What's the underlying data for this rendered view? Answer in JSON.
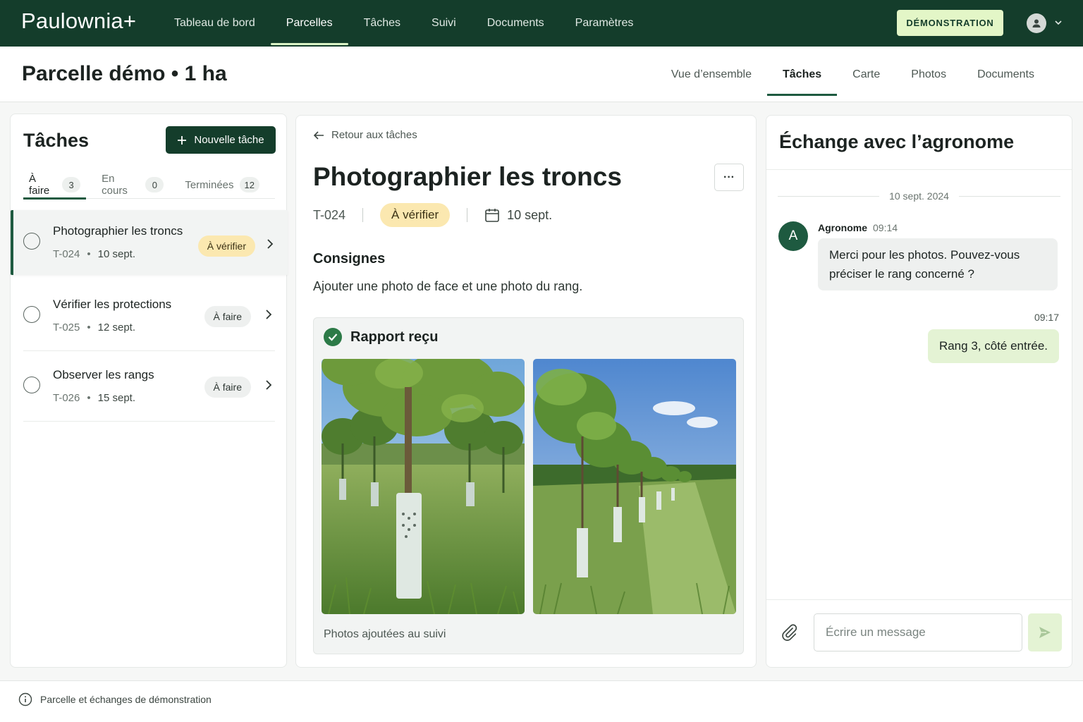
{
  "app": {
    "brand": "Paulownia+"
  },
  "nav": {
    "items": [
      {
        "label": "Tableau de bord"
      },
      {
        "label": "Parcelles"
      },
      {
        "label": "Tâches"
      },
      {
        "label": "Suivi"
      },
      {
        "label": "Documents"
      },
      {
        "label": "Paramètres"
      }
    ],
    "active": "Parcelles",
    "demo_label": "DÉMONSTRATION"
  },
  "header": {
    "title": "Parcelle démo • 1 ha",
    "tabs": [
      {
        "label": "Vue d’ensemble"
      },
      {
        "label": "Tâches"
      },
      {
        "label": "Carte"
      },
      {
        "label": "Photos"
      },
      {
        "label": "Documents"
      }
    ],
    "active_tab": "Tâches"
  },
  "tasks_panel": {
    "title": "Tâches",
    "new_task_label": "Nouvelle tâche",
    "tabs": [
      {
        "label": "À faire",
        "count": "3"
      },
      {
        "label": "En cours",
        "count": "0"
      },
      {
        "label": "Terminées",
        "count": "12"
      }
    ],
    "items": [
      {
        "name": "Photographier les troncs",
        "id": "T-024",
        "date": "10 sept.",
        "status": "À vérifier",
        "selected": true
      },
      {
        "name": "Vérifier les protections",
        "id": "T-025",
        "date": "12 sept.",
        "status": "À faire"
      },
      {
        "name": "Observer les rangs",
        "id": "T-026",
        "date": "15 sept.",
        "status": "À faire"
      }
    ]
  },
  "detail": {
    "back_label": "Retour aux tâches",
    "title": "Photographier les troncs",
    "more_label": "···",
    "id": "T-024",
    "status": "À vérifier",
    "date": "10 sept.",
    "instructions_title": "Consignes",
    "instructions": "Ajouter une photo de face et une photo du rang.",
    "report_title": "Rapport reçu",
    "report_footer": "Photos ajoutées au suivi"
  },
  "chat": {
    "title": "Échange avec l’agronome",
    "date_separator": "10 sept. 2024",
    "messages": [
      {
        "avatar": "A",
        "author": "Agronome",
        "time": "09:14",
        "text": "Merci pour les photos. Pouvez-vous préciser le rang concerné ?"
      },
      {
        "time": "09:17",
        "text": "Rang 3, côté entrée."
      }
    ],
    "input_placeholder": "Écrire un message"
  },
  "footer": {
    "text": "Parcelle et échanges de démonstration"
  },
  "colors": {
    "primary": "#143d2b",
    "accent": "#e3f6c7",
    "pending_badge": "#fbe8b0",
    "success": "#2c7a47"
  },
  "icons": [
    "plus-icon",
    "chevron-right-icon",
    "arrow-left-icon",
    "calendar-icon",
    "check-circle-icon",
    "paperclip-icon",
    "send-icon",
    "info-icon",
    "user-icon",
    "chevron-down-icon"
  ]
}
